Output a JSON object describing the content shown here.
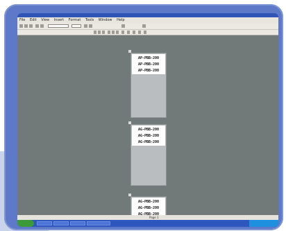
{
  "menubar": {
    "items": [
      "File",
      "Edit",
      "View",
      "Insert",
      "Format",
      "Tools",
      "Window",
      "Help"
    ]
  },
  "toolbar": {
    "font_field": "",
    "size_field": ""
  },
  "pages": [
    {
      "lines": [
        "AP-PBB-200",
        "AP-PBB-200",
        "AP-PBB-200"
      ]
    },
    {
      "lines": [
        "AG-PBB-200",
        "AG-PBB-200",
        "AG-PBB-200"
      ]
    },
    {
      "lines": [
        "AG-PBB-200",
        "AG-PBB-200",
        "AG-PBB-200"
      ]
    }
  ],
  "statusbar": {
    "page_info": "Page 1",
    "right_info": ""
  },
  "taskbar": {
    "items": [
      "",
      "",
      "",
      ""
    ],
    "clock": ""
  }
}
